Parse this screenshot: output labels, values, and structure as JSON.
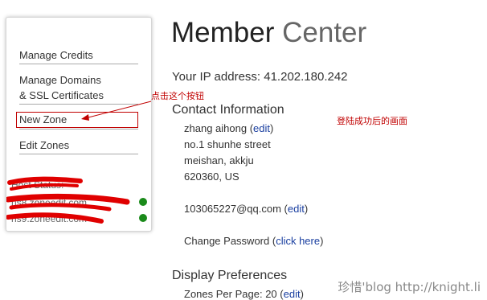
{
  "sidebar": {
    "items": [
      {
        "label": "Manage Credits"
      },
      {
        "label_line1": "Manage Domains",
        "label_line2": "& SSL Certificates"
      },
      {
        "label": "New Zone"
      },
      {
        "label": "Edit Zones"
      }
    ],
    "status_label": "Host Status:",
    "status_rows": [
      {
        "text": "ns8.zoneedit.com",
        "status": "online"
      },
      {
        "text": "ns9.zoneedit.com",
        "status": "online"
      }
    ],
    "status_color": "#1a8a1a"
  },
  "header": {
    "title_part1": "Member",
    "title_part2": "Center"
  },
  "ip": {
    "label": "Your IP address:",
    "value": "41.202.180.242"
  },
  "contact": {
    "heading": "Contact Information",
    "name": "zhang aihong",
    "edit_label": "edit",
    "street": "no.1 shunhe street",
    "city_line": "meishan, akkju",
    "postal_line": "620360, US",
    "email": "103065227@qq.com",
    "change_password_label": "Change Password",
    "click_here_label": "click here"
  },
  "display": {
    "heading": "Display Preferences",
    "zones_per_page_label": "Zones Per Page:",
    "zones_per_page_value": "20"
  },
  "annotations": {
    "click_button": "点击这个按钮",
    "after_login": "登陆成功后的画面",
    "color": "#c00000"
  },
  "watermark": "珍惜'blog http://knight.li"
}
